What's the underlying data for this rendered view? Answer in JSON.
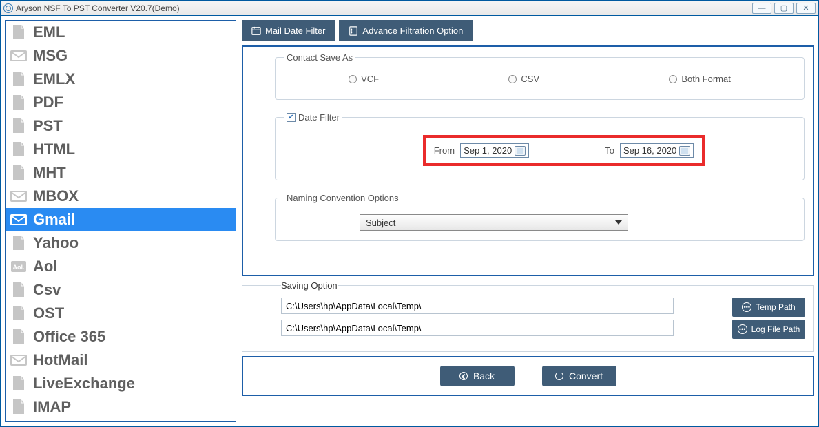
{
  "window": {
    "title": "Aryson NSF To PST Converter V20.7(Demo)"
  },
  "sidebar": {
    "items": [
      {
        "label": "EML",
        "icon": "file-eml",
        "active": false
      },
      {
        "label": "MSG",
        "icon": "envelope",
        "active": false
      },
      {
        "label": "EMLX",
        "icon": "file-emlx",
        "active": false
      },
      {
        "label": "PDF",
        "icon": "file-pdf",
        "active": false
      },
      {
        "label": "PST",
        "icon": "file-pst",
        "active": false
      },
      {
        "label": "HTML",
        "icon": "file-html",
        "active": false
      },
      {
        "label": "MHT",
        "icon": "file-mht",
        "active": false
      },
      {
        "label": "MBOX",
        "icon": "mailbox",
        "active": false
      },
      {
        "label": "Gmail",
        "icon": "gmail",
        "active": true
      },
      {
        "label": "Yahoo",
        "icon": "yahoo",
        "active": false
      },
      {
        "label": "Aol",
        "icon": "aol",
        "active": false
      },
      {
        "label": "Csv",
        "icon": "file-csv",
        "active": false
      },
      {
        "label": "OST",
        "icon": "file-ost",
        "active": false
      },
      {
        "label": "Office 365",
        "icon": "office365",
        "active": false
      },
      {
        "label": "HotMail",
        "icon": "hotmail",
        "active": false
      },
      {
        "label": "LiveExchange",
        "icon": "exchange",
        "active": false
      },
      {
        "label": "IMAP",
        "icon": "imap",
        "active": false
      }
    ]
  },
  "tabs": {
    "mail_date_filter": "Mail Date Filter",
    "advance_filtration": "Advance Filtration Option"
  },
  "contact_save_as": {
    "legend": "Contact Save As",
    "opts": {
      "vcf": "VCF",
      "csv": "CSV",
      "both": "Both Format"
    }
  },
  "date_filter": {
    "legend": "Date Filter",
    "checked": true,
    "from_label": "From",
    "from_value": "Sep 1, 2020",
    "to_label": "To",
    "to_value": "Sep 16, 2020"
  },
  "naming": {
    "legend": "Naming Convention Options",
    "selected": "Subject"
  },
  "saving": {
    "legend": "Saving Option",
    "temp_path": "C:\\Users\\hp\\AppData\\Local\\Temp\\",
    "log_path": "C:\\Users\\hp\\AppData\\Local\\Temp\\",
    "temp_btn": "Temp Path",
    "log_btn": "Log File Path"
  },
  "buttons": {
    "back": "Back",
    "convert": "Convert"
  }
}
